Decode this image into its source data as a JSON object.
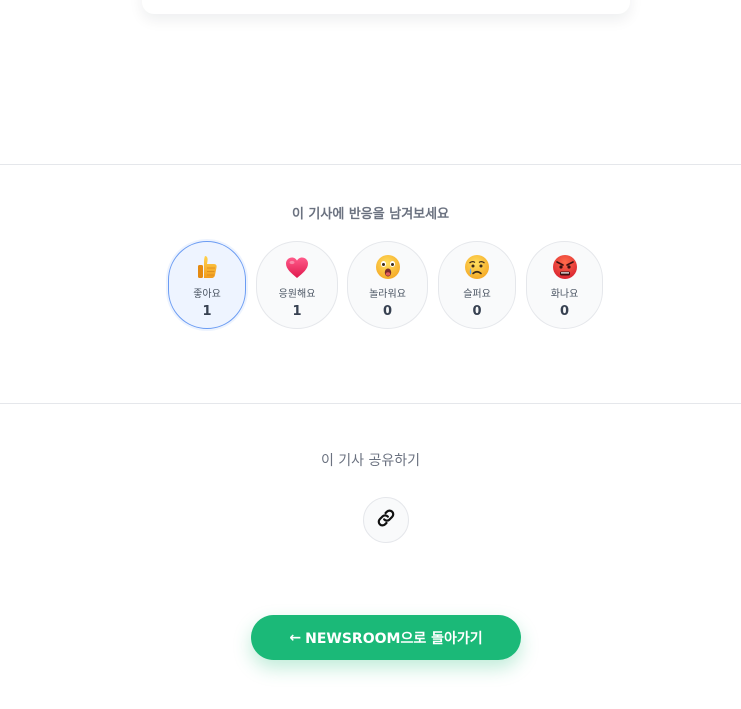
{
  "reactions_section": {
    "title": "이 기사에 반응을 남겨보세요",
    "items": [
      {
        "label": "좋아요",
        "count": "1",
        "icon": "thumbs-up-icon",
        "active": true
      },
      {
        "label": "응원해요",
        "count": "1",
        "icon": "heart-icon",
        "active": false
      },
      {
        "label": "놀라워요",
        "count": "0",
        "icon": "surprised-face-icon",
        "active": false
      },
      {
        "label": "슬퍼요",
        "count": "0",
        "icon": "sad-face-icon",
        "active": false
      },
      {
        "label": "화나요",
        "count": "0",
        "icon": "angry-face-icon",
        "active": false
      }
    ]
  },
  "share_section": {
    "title": "이 기사 공유하기",
    "copy_link_icon": "link-icon"
  },
  "back_button": {
    "arrow": "←",
    "label": "NEWSROOM으로 돌아가기"
  },
  "colors": {
    "accent_green": "#1bb978",
    "active_blue": "#6b9cf3",
    "muted_text": "#6b7280"
  }
}
